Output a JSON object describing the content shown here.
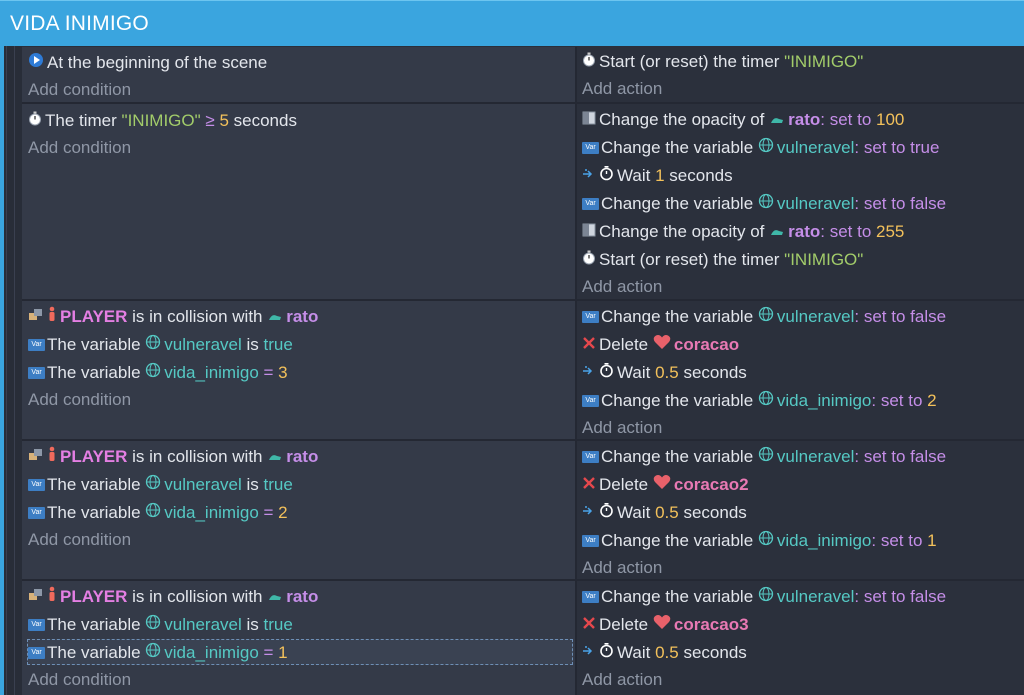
{
  "group": {
    "title": "VIDA INIMIGO"
  },
  "labels": {
    "add_condition": "Add condition",
    "add_action": "Add action",
    "var_badge": "Var"
  },
  "events": [
    {
      "conditions": [
        {
          "t": "At the beginning of the scene"
        }
      ],
      "actions": [
        {
          "t1": "Start (or reset) the timer ",
          "str": "\"INIMIGO\""
        }
      ]
    },
    {
      "conditions": [
        {
          "t1": "The timer ",
          "str": "\"INIMIGO\"",
          "op": " ≥ ",
          "num": "5",
          "t2": " seconds"
        }
      ],
      "actions": [
        {
          "t1": "Change the opacity of ",
          "obj": "rato",
          "kw": ": set to ",
          "num": "100"
        },
        {
          "t1": "Change the variable ",
          "var": "vulneravel",
          "kw": ": set to true"
        },
        {
          "t1": "Wait ",
          "num": "1",
          "t2": " seconds"
        },
        {
          "t1": "Change the variable ",
          "var": "vulneravel",
          "kw": ": set to false"
        },
        {
          "t1": "Change the opacity of ",
          "obj": "rato",
          "kw": ": set to ",
          "num": "255"
        },
        {
          "t1": "Start (or reset) the timer ",
          "str": "\"INIMIGO\""
        }
      ]
    },
    {
      "conditions": [
        {
          "obj1": "PLAYER",
          "t1": " is in collision with ",
          "obj2": "rato"
        },
        {
          "t1": "The variable ",
          "var": "vulneravel",
          "t2": " is ",
          "val": "true"
        },
        {
          "t1": "The variable ",
          "var": "vida_inimigo",
          "op": " = ",
          "num": "3"
        }
      ],
      "actions": [
        {
          "t1": "Change the variable ",
          "var": "vulneravel",
          "kw": ": set to false"
        },
        {
          "t1": "Delete ",
          "obj": "coracao"
        },
        {
          "t1": "Wait ",
          "num": "0.5",
          "t2": " seconds"
        },
        {
          "t1": "Change the variable ",
          "var": "vida_inimigo",
          "kw": ": set to ",
          "num": "2"
        }
      ]
    },
    {
      "conditions": [
        {
          "obj1": "PLAYER",
          "t1": " is in collision with ",
          "obj2": "rato"
        },
        {
          "t1": "The variable ",
          "var": "vulneravel",
          "t2": " is ",
          "val": "true"
        },
        {
          "t1": "The variable ",
          "var": "vida_inimigo",
          "op": " = ",
          "num": "2"
        }
      ],
      "actions": [
        {
          "t1": "Change the variable ",
          "var": "vulneravel",
          "kw": ": set to false"
        },
        {
          "t1": "Delete ",
          "obj": "coracao2"
        },
        {
          "t1": "Wait ",
          "num": "0.5",
          "t2": " seconds"
        },
        {
          "t1": "Change the variable ",
          "var": "vida_inimigo",
          "kw": ": set to ",
          "num": "1"
        }
      ]
    },
    {
      "conditions": [
        {
          "obj1": "PLAYER",
          "t1": " is in collision with ",
          "obj2": "rato"
        },
        {
          "t1": "The variable ",
          "var": "vulneravel",
          "t2": " is ",
          "val": "true"
        },
        {
          "t1": "The variable ",
          "var": "vida_inimigo",
          "op": " = ",
          "num": "1"
        }
      ],
      "actions": [
        {
          "t1": "Change the variable ",
          "var": "vulneravel",
          "kw": ": set to false"
        },
        {
          "t1": "Delete ",
          "obj": "coracao3"
        },
        {
          "t1": "Wait ",
          "num": "0.5",
          "t2": " seconds"
        }
      ]
    }
  ]
}
